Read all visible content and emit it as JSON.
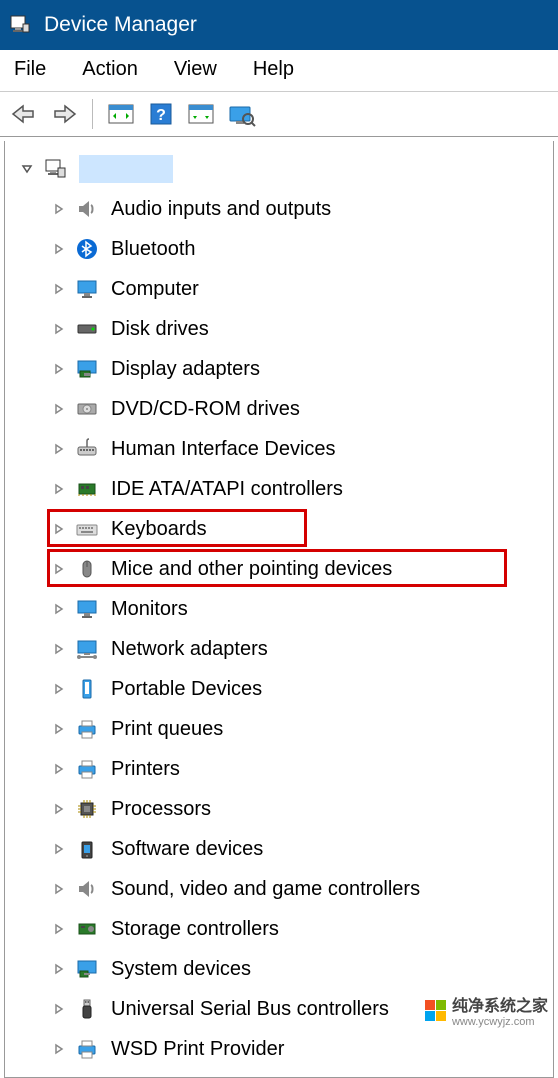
{
  "window": {
    "title": "Device Manager"
  },
  "menu": {
    "file": "File",
    "action": "Action",
    "view": "View",
    "help": "Help"
  },
  "root": {
    "label": ""
  },
  "devices": [
    {
      "label": "Audio inputs and outputs",
      "icon": "speaker"
    },
    {
      "label": "Bluetooth",
      "icon": "bluetooth"
    },
    {
      "label": "Computer",
      "icon": "monitor"
    },
    {
      "label": "Disk drives",
      "icon": "disk"
    },
    {
      "label": "Display adapters",
      "icon": "display"
    },
    {
      "label": "DVD/CD-ROM drives",
      "icon": "dvd"
    },
    {
      "label": "Human Interface Devices",
      "icon": "hid"
    },
    {
      "label": "IDE ATA/ATAPI controllers",
      "icon": "ide"
    },
    {
      "label": "Keyboards",
      "icon": "keyboard",
      "highlight": true
    },
    {
      "label": "Mice and other pointing devices",
      "icon": "mouse",
      "highlight": true
    },
    {
      "label": "Monitors",
      "icon": "monitor2"
    },
    {
      "label": "Network adapters",
      "icon": "network"
    },
    {
      "label": "Portable Devices",
      "icon": "portable"
    },
    {
      "label": "Print queues",
      "icon": "printer"
    },
    {
      "label": "Printers",
      "icon": "printer"
    },
    {
      "label": "Processors",
      "icon": "cpu"
    },
    {
      "label": "Software devices",
      "icon": "software"
    },
    {
      "label": "Sound, video and game controllers",
      "icon": "speaker"
    },
    {
      "label": "Storage controllers",
      "icon": "storage"
    },
    {
      "label": "System devices",
      "icon": "system"
    },
    {
      "label": "Universal Serial Bus controllers",
      "icon": "usb"
    },
    {
      "label": "WSD Print Provider",
      "icon": "printer"
    }
  ],
  "watermark": {
    "text": "纯净系统之家",
    "url": "www.ycwyjz.com"
  },
  "colors": {
    "titlebar": "#07528f",
    "highlight": "#d40000",
    "selection": "#cde6ff"
  }
}
